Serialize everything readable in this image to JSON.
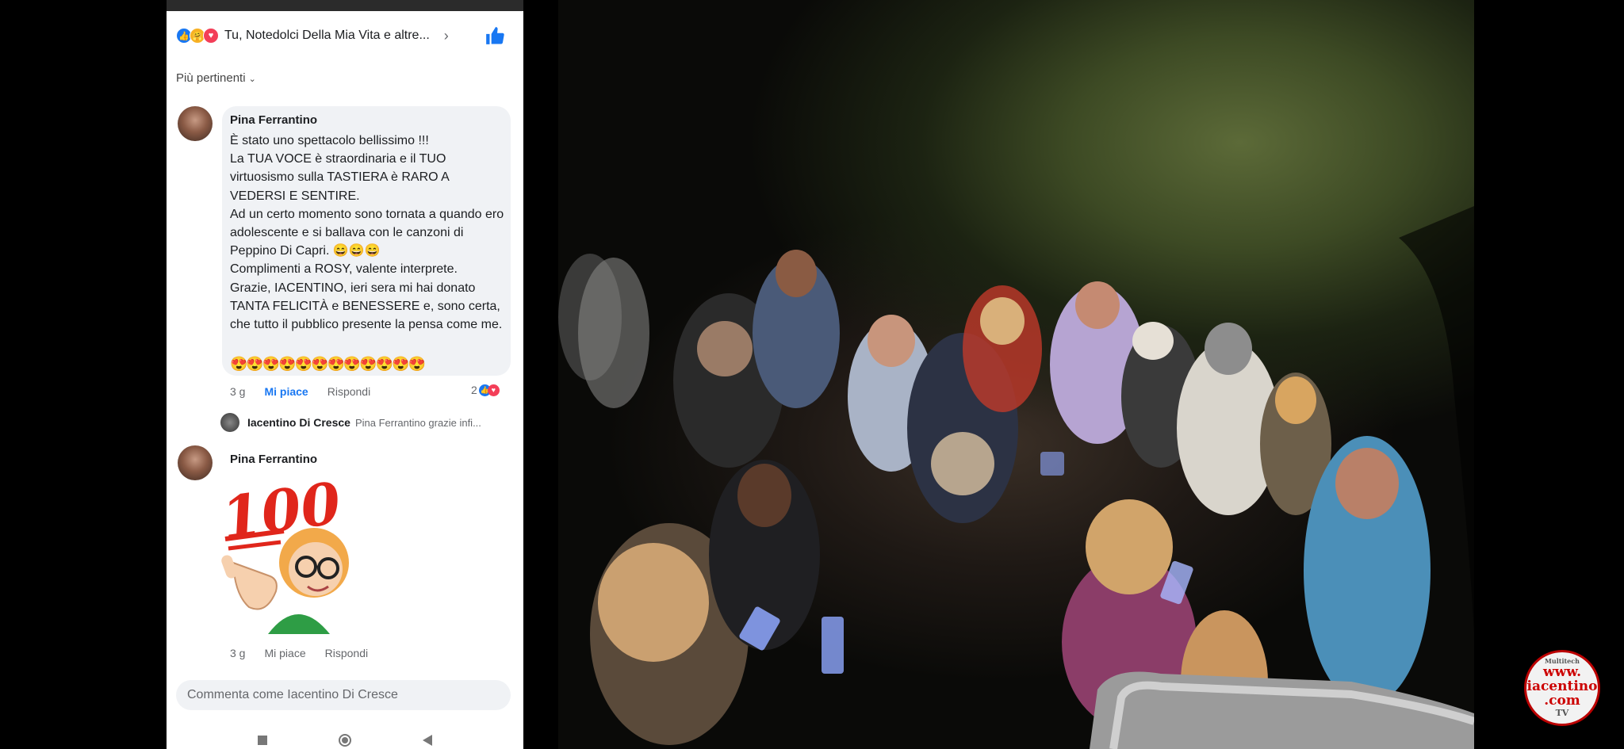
{
  "facebook": {
    "reactions_summary": "Tu, Notedolci Della Mia Vita e altre...",
    "sort_label": "Più pertinenti",
    "comments": [
      {
        "author": "Pina Ferrantino",
        "text": "È stato uno spettacolo bellissimo !!!\nLa TUA VOCE è straordinaria e il TUO virtuosismo sulla TASTIERA è RARO A VEDERSI E SENTIRE.\nAd un certo momento sono tornata a quando ero adolescente e si ballava con le canzoni di Peppino Di Capri. 😄😄😄\nComplimenti a ROSY, valente interprete.\nGrazie, IACENTINO, ieri sera mi hai donato TANTA FELICITÀ e BENESSERE e, sono certa, che tutto il pubblico presente la pensa come me.",
        "hearts": "😍😍😍😍😍😍😍😍😍😍😍😍",
        "time": "3 g",
        "like_label": "Mi piace",
        "reply_label": "Rispondi",
        "reaction_count": "2"
      },
      {
        "author": "Pina Ferrantino",
        "time": "3 g",
        "like_label": "Mi piace",
        "reply_label": "Rispondi",
        "sticker": "100-emoji-sticker"
      }
    ],
    "reply_preview": {
      "author": "Iacentino Di Cresce",
      "snippet": "Pina Ferrantino grazie infi..."
    },
    "comment_placeholder": "Commenta come Iacentino Di Cresce"
  },
  "watermark": {
    "top": "Multitech",
    "line1": "www.",
    "line2": "iacentino",
    "line3": ".com",
    "tv": "TV"
  },
  "colors": {
    "facebook_blue": "#1877f2",
    "love_red": "#f33e58",
    "bubble_gray": "#f0f2f5"
  }
}
